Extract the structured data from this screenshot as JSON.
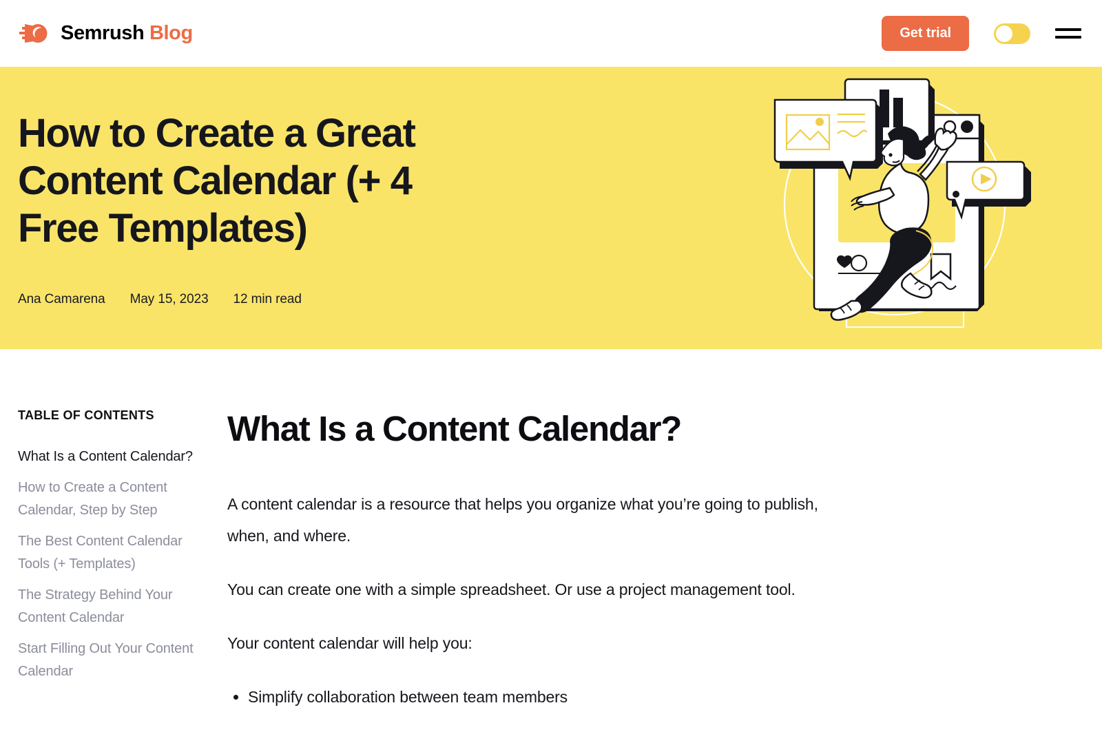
{
  "header": {
    "brand_name": "Semrush",
    "brand_section": "Blog",
    "logo_icon": "semrush-comet-logo",
    "get_trial_label": "Get trial",
    "theme_toggle_icon": "theme-toggle-switch",
    "menu_icon": "hamburger-menu-icon",
    "accent_orange": "#ec6c45",
    "toggle_yellow": "#f6d34e"
  },
  "hero": {
    "background_color": "#f9e468",
    "title": "How to Create a Great Content Calendar (+ 4 Free Templates)",
    "author": "Ana Camarena",
    "date": "May 15, 2023",
    "read_time": "12 min read",
    "illustration_name": "person-climbing-social-media-post-illustration"
  },
  "toc": {
    "heading": "TABLE OF CONTENTS",
    "items": [
      {
        "label": "What Is a Content Calendar?",
        "active": true
      },
      {
        "label": "How to Create a Content Calendar, Step by Step",
        "active": false
      },
      {
        "label": "The Best Content Calendar Tools (+ Templates)",
        "active": false
      },
      {
        "label": "The Strategy Behind Your Content Calendar",
        "active": false
      },
      {
        "label": "Start Filling Out Your Content Calendar",
        "active": false
      }
    ]
  },
  "article": {
    "heading": "What Is a Content Calendar?",
    "paragraphs": [
      "A content calendar is a resource that helps you organize what you’re going to publish, when, and where.",
      "You can create one with a simple spreadsheet. Or use a project management tool.",
      "Your content calendar will help you:"
    ],
    "bullets": [
      "Simplify collaboration between team members"
    ]
  }
}
